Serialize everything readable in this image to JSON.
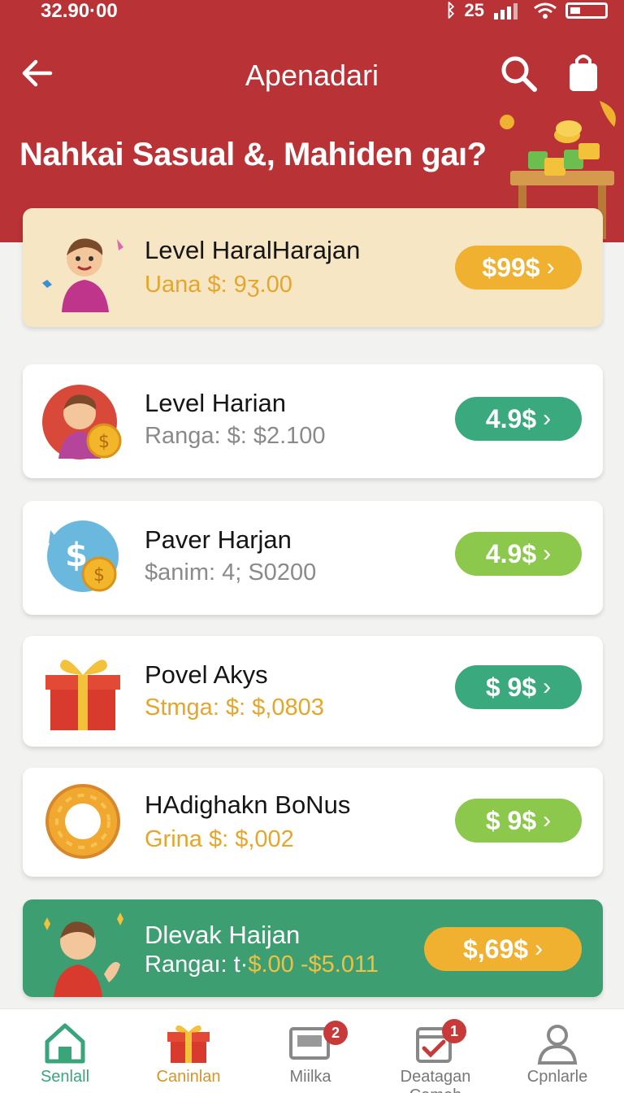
{
  "status_bar": {
    "time": "32.90·00",
    "signal_text": "25"
  },
  "topbar": {
    "title": "Apenadari"
  },
  "hero": {
    "question": "Nahkai Sasual &, Mahiden gaı?"
  },
  "cards": [
    {
      "title": "Level HaralHarajan",
      "subtitle_label": "Uana $: 9ʒ.00",
      "subtitle_value": "",
      "pill": "$99$",
      "pill_color": "#f0b030",
      "bg": "#f7e6c4"
    },
    {
      "title": "Level Harian",
      "subtitle_label": "Ranga: $: $2.100",
      "subtitle_value": "",
      "pill": "4.9$",
      "pill_color": "#3aaa7e",
      "bg": "#ffffff"
    },
    {
      "title": "Paver Harjan",
      "subtitle_label": "$anim: 4; S0200",
      "subtitle_value": "",
      "pill": "4.9$",
      "pill_color": "#8cc84b",
      "bg": "#ffffff"
    },
    {
      "title": "Povel Akys",
      "subtitle_label": "Stmga: $: $,0803",
      "subtitle_value": "",
      "pill": "$ 9$",
      "pill_color": "#3aaa7e",
      "bg": "#ffffff"
    },
    {
      "title": "HAdighakn BoNus",
      "subtitle_label": "Grina $: $,002",
      "subtitle_value": "",
      "pill": "$ 9$",
      "pill_color": "#8cc84b",
      "bg": "#ffffff"
    }
  ],
  "promo": {
    "title": "Dlevak Haijan",
    "subtitle_label": "Rangaı: t·",
    "subtitle_value": "$.00 -$5.011",
    "pill": "$,69$",
    "pill_color": "#f0b030",
    "bg": "#3d9e72"
  },
  "bottom_nav": [
    {
      "label": "Senlall",
      "icon": "home-icon",
      "active": true,
      "color": "#3aa57a"
    },
    {
      "label": "Caninlan",
      "icon": "gift-icon",
      "active": false,
      "color": "#d4952a"
    },
    {
      "label": "Miilka",
      "icon": "monitor-icon",
      "badge": "2",
      "color": "#777777"
    },
    {
      "label": "Deatagan Cameh",
      "icon": "calendar-check-icon",
      "badge": "1",
      "color": "#777777"
    },
    {
      "label": "Cpnlarle",
      "icon": "profile-icon",
      "color": "#777777"
    }
  ],
  "colors": {
    "header": "#b83236",
    "accent_green": "#3aaa7e",
    "accent_lime": "#8cc84b",
    "accent_gold": "#f0b030"
  }
}
